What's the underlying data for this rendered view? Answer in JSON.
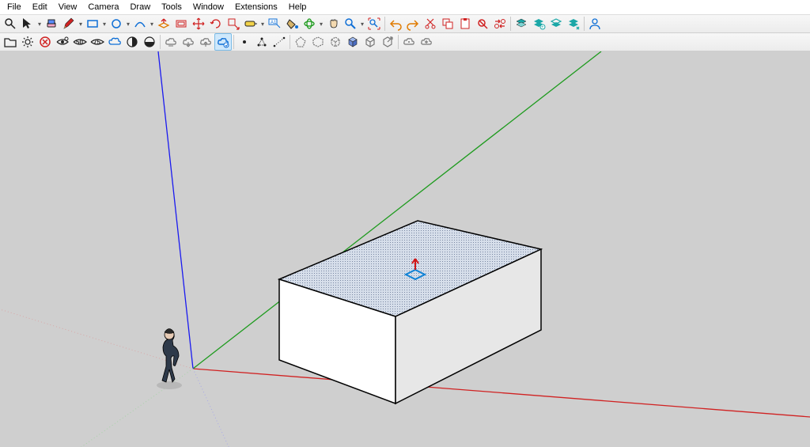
{
  "menus": [
    "File",
    "Edit",
    "View",
    "Camera",
    "Draw",
    "Tools",
    "Window",
    "Extensions",
    "Help"
  ],
  "toolbar1_icons": [
    "search",
    "select",
    "dropdown",
    "eraser",
    "pencil",
    "dropdown",
    "rectangle",
    "dropdown",
    "circle",
    "dropdown",
    "arc",
    "dropdown",
    "push-pull",
    "offset",
    "move",
    "rotate",
    "scale",
    "tape-measure",
    "dropdown",
    "text",
    "paint-bucket",
    "orbit",
    "dropdown",
    "pan",
    "zoom",
    "dropdown",
    "zoom-extents",
    "sep",
    "undo",
    "redo",
    "cut",
    "copy",
    "paste",
    "delete",
    "replace",
    "sep",
    "layers-a",
    "layers-b",
    "layers-c",
    "layers-d",
    "sep",
    "user"
  ],
  "toolbar2_icons": [
    "open",
    "settings",
    "close-red",
    "eye-a",
    "eye-50",
    "eye-75",
    "cloud",
    "contrast",
    "circle-half",
    "sep",
    "cloud-1",
    "cloud-2",
    "cloud-3",
    "cloud-selected",
    "sep",
    "dot",
    "triangle",
    "dots-line",
    "sep",
    "outline-pent",
    "outline-hex",
    "outline-cube",
    "solid-cube",
    "outline-box",
    "arrow-box",
    "sep",
    "cloud-a",
    "cloud-b"
  ],
  "colors": {
    "axis_red": "#d02222",
    "axis_green": "#1e9b1e",
    "axis_blue": "#1a1af0",
    "dash": "#a0a0a0"
  }
}
